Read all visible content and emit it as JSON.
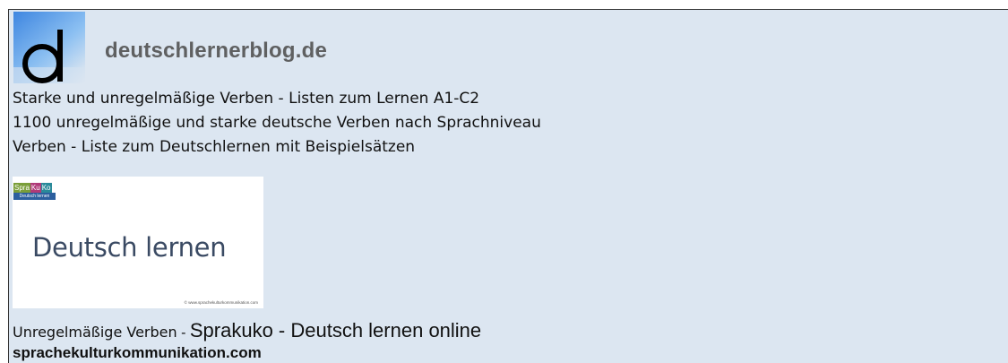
{
  "header": {
    "site_title": "deutschlernerblog.de",
    "logo_icon": "letter-d-logo"
  },
  "links": [
    "Starke und unregelmäßige Verben - Listen zum Lernen A1-C2",
    "1100 unregelmäßige und starke deutsche Verben nach Sprachniveau",
    "Verben - Liste zum Deutschlernen mit Beispielsätzen"
  ],
  "thumbnail": {
    "badge": [
      "Spra",
      "Ku",
      "Ko"
    ],
    "badge_sub": "Deutsch lernen",
    "title": "Deutsch lernen",
    "copyright": "© www.sprachekulturkommunikation.com"
  },
  "caption": {
    "prefix": "Unregelmäßige Verben",
    "separator": " - ",
    "rest": "Sprakuko - Deutsch lernen online"
  },
  "domain": "sprachekulturkommunikation.com",
  "colors": {
    "panel_bg": "#dce6f1",
    "logo_blue": "#5aa0e8",
    "title_gray": "#5f6061",
    "badge_green": "#7a9e3a",
    "badge_pink": "#b03a78",
    "badge_teal": "#2a8a9a"
  }
}
